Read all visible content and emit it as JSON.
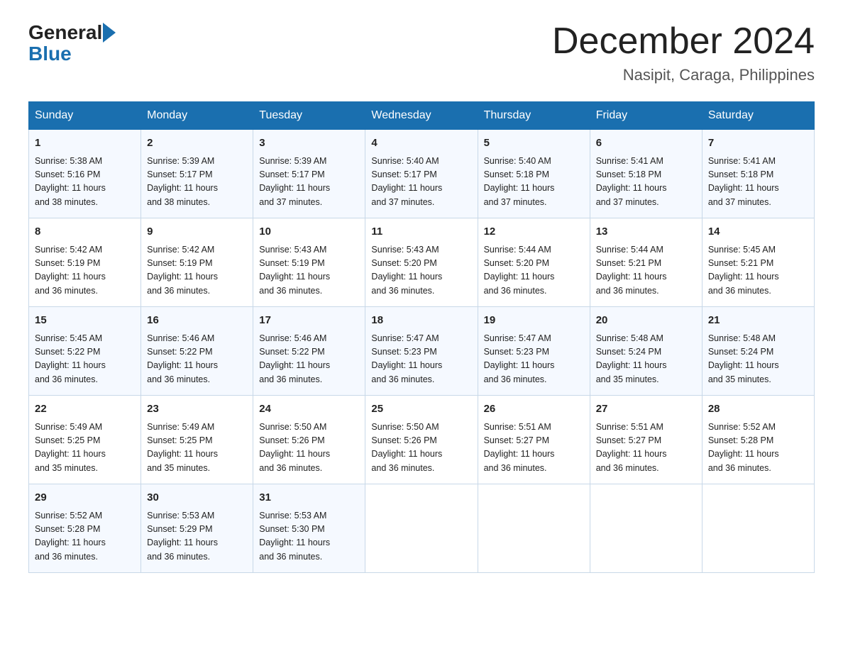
{
  "header": {
    "logo_general": "General",
    "logo_blue": "Blue",
    "month_title": "December 2024",
    "subtitle": "Nasipit, Caraga, Philippines"
  },
  "days_of_week": [
    "Sunday",
    "Monday",
    "Tuesday",
    "Wednesday",
    "Thursday",
    "Friday",
    "Saturday"
  ],
  "weeks": [
    [
      {
        "day": "1",
        "sunrise": "5:38 AM",
        "sunset": "5:16 PM",
        "daylight": "11 hours and 38 minutes."
      },
      {
        "day": "2",
        "sunrise": "5:39 AM",
        "sunset": "5:17 PM",
        "daylight": "11 hours and 38 minutes."
      },
      {
        "day": "3",
        "sunrise": "5:39 AM",
        "sunset": "5:17 PM",
        "daylight": "11 hours and 37 minutes."
      },
      {
        "day": "4",
        "sunrise": "5:40 AM",
        "sunset": "5:17 PM",
        "daylight": "11 hours and 37 minutes."
      },
      {
        "day": "5",
        "sunrise": "5:40 AM",
        "sunset": "5:18 PM",
        "daylight": "11 hours and 37 minutes."
      },
      {
        "day": "6",
        "sunrise": "5:41 AM",
        "sunset": "5:18 PM",
        "daylight": "11 hours and 37 minutes."
      },
      {
        "day": "7",
        "sunrise": "5:41 AM",
        "sunset": "5:18 PM",
        "daylight": "11 hours and 37 minutes."
      }
    ],
    [
      {
        "day": "8",
        "sunrise": "5:42 AM",
        "sunset": "5:19 PM",
        "daylight": "11 hours and 36 minutes."
      },
      {
        "day": "9",
        "sunrise": "5:42 AM",
        "sunset": "5:19 PM",
        "daylight": "11 hours and 36 minutes."
      },
      {
        "day": "10",
        "sunrise": "5:43 AM",
        "sunset": "5:19 PM",
        "daylight": "11 hours and 36 minutes."
      },
      {
        "day": "11",
        "sunrise": "5:43 AM",
        "sunset": "5:20 PM",
        "daylight": "11 hours and 36 minutes."
      },
      {
        "day": "12",
        "sunrise": "5:44 AM",
        "sunset": "5:20 PM",
        "daylight": "11 hours and 36 minutes."
      },
      {
        "day": "13",
        "sunrise": "5:44 AM",
        "sunset": "5:21 PM",
        "daylight": "11 hours and 36 minutes."
      },
      {
        "day": "14",
        "sunrise": "5:45 AM",
        "sunset": "5:21 PM",
        "daylight": "11 hours and 36 minutes."
      }
    ],
    [
      {
        "day": "15",
        "sunrise": "5:45 AM",
        "sunset": "5:22 PM",
        "daylight": "11 hours and 36 minutes."
      },
      {
        "day": "16",
        "sunrise": "5:46 AM",
        "sunset": "5:22 PM",
        "daylight": "11 hours and 36 minutes."
      },
      {
        "day": "17",
        "sunrise": "5:46 AM",
        "sunset": "5:22 PM",
        "daylight": "11 hours and 36 minutes."
      },
      {
        "day": "18",
        "sunrise": "5:47 AM",
        "sunset": "5:23 PM",
        "daylight": "11 hours and 36 minutes."
      },
      {
        "day": "19",
        "sunrise": "5:47 AM",
        "sunset": "5:23 PM",
        "daylight": "11 hours and 36 minutes."
      },
      {
        "day": "20",
        "sunrise": "5:48 AM",
        "sunset": "5:24 PM",
        "daylight": "11 hours and 35 minutes."
      },
      {
        "day": "21",
        "sunrise": "5:48 AM",
        "sunset": "5:24 PM",
        "daylight": "11 hours and 35 minutes."
      }
    ],
    [
      {
        "day": "22",
        "sunrise": "5:49 AM",
        "sunset": "5:25 PM",
        "daylight": "11 hours and 35 minutes."
      },
      {
        "day": "23",
        "sunrise": "5:49 AM",
        "sunset": "5:25 PM",
        "daylight": "11 hours and 35 minutes."
      },
      {
        "day": "24",
        "sunrise": "5:50 AM",
        "sunset": "5:26 PM",
        "daylight": "11 hours and 36 minutes."
      },
      {
        "day": "25",
        "sunrise": "5:50 AM",
        "sunset": "5:26 PM",
        "daylight": "11 hours and 36 minutes."
      },
      {
        "day": "26",
        "sunrise": "5:51 AM",
        "sunset": "5:27 PM",
        "daylight": "11 hours and 36 minutes."
      },
      {
        "day": "27",
        "sunrise": "5:51 AM",
        "sunset": "5:27 PM",
        "daylight": "11 hours and 36 minutes."
      },
      {
        "day": "28",
        "sunrise": "5:52 AM",
        "sunset": "5:28 PM",
        "daylight": "11 hours and 36 minutes."
      }
    ],
    [
      {
        "day": "29",
        "sunrise": "5:52 AM",
        "sunset": "5:28 PM",
        "daylight": "11 hours and 36 minutes."
      },
      {
        "day": "30",
        "sunrise": "5:53 AM",
        "sunset": "5:29 PM",
        "daylight": "11 hours and 36 minutes."
      },
      {
        "day": "31",
        "sunrise": "5:53 AM",
        "sunset": "5:30 PM",
        "daylight": "11 hours and 36 minutes."
      },
      null,
      null,
      null,
      null
    ]
  ],
  "labels": {
    "sunrise": "Sunrise:",
    "sunset": "Sunset:",
    "daylight": "Daylight:"
  }
}
